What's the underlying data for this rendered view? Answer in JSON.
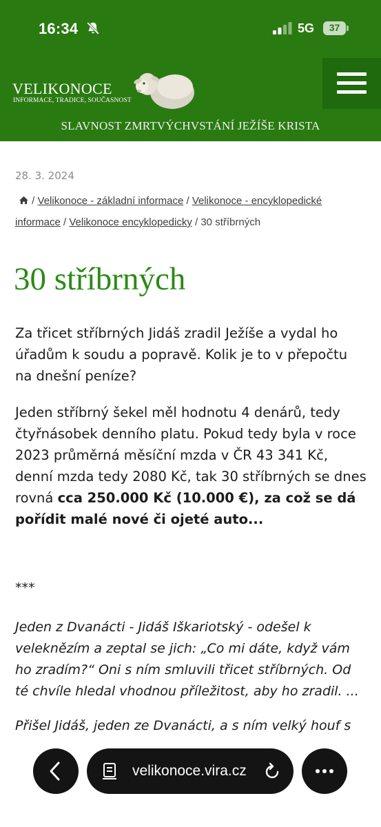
{
  "status_bar": {
    "time": "16:34",
    "network": "5G",
    "battery": "37"
  },
  "site": {
    "title": "VELIKONOCE",
    "subtitle": "INFORMACE, TRADICE, SOUČASNOST",
    "tagline": "SLAVNOST ZMRTVÝCHVSTÁNÍ JEŽÍŠE KRISTA",
    "colors": {
      "header_green": "#2a7a12",
      "menu_green": "#1f6a0c",
      "title_green": "#2c8a16"
    }
  },
  "article": {
    "date": "28. 3. 2024",
    "breadcrumb": {
      "sep": " / ",
      "items": [
        "Velikonoce - základní informace",
        "Velikonoce - encyklopedické informace",
        "Velikonoce encyklopedicky"
      ],
      "current": "30 stříbrných"
    },
    "title": "30 stříbrných",
    "p1": "Za třicet stříbrných Jidáš zradil Ježíše a vydal ho úřadům k soudu a popravě. Kolik je to v přepočtu na dnešní peníze?",
    "p2_text": "Jeden stříbrný šekel měl hodnotu 4 denárů, tedy čtyřnásobek denního platu. Pokud tedy byla v roce 2023 průměrná měsíční mzda v ČR 43 341 Kč, denní mzda tedy 2080 Kč, tak 30 stříbrných se dnes rovná ",
    "p2_bold": "cca 250.000 Kč (10.000 €), za což se dá pořídit malé nové či ojeté auto...",
    "separator": "***",
    "p3": "Jeden z Dvanácti - Jidáš Iškariotský - odešel k veleknězím a zeptal se jich: „Co mi dáte, když vám ho zradím?“ Oni s ním smluvili třicet stříbrných. Od té chvíle hledal vhodnou příležitost, aby ho zradil. ...",
    "p4": "Přišel Jidáš, jeden ze Dvanácti, a s ním velký houf s"
  },
  "browser": {
    "url": "velikonoce.vira.cz",
    "icons": [
      "back-arrow-icon",
      "page-icon",
      "reload-icon",
      "more-icon"
    ]
  }
}
